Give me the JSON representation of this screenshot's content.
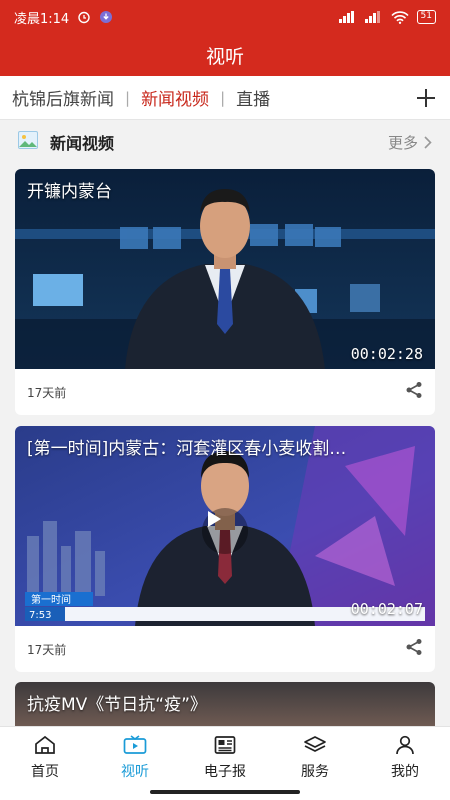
{
  "status_bar": {
    "time": "凌晨1:14",
    "battery": "51"
  },
  "header": {
    "title": "视听"
  },
  "tabs": [
    {
      "label": "杭锦后旗新闻",
      "active": false
    },
    {
      "label": "新闻视频",
      "active": true
    },
    {
      "label": "直播",
      "active": false
    }
  ],
  "section": {
    "title": "新闻视频",
    "more_label": "更多"
  },
  "videos": [
    {
      "title": "开镰内蒙台",
      "duration": "00:02:28",
      "age": "17天前"
    },
    {
      "title": "[第一时间]内蒙古：河套灌区春小麦收割…",
      "duration": "00:02:07",
      "age": "17天前"
    },
    {
      "title": "抗疫MV《节日抗“疫”》"
    }
  ],
  "bottom_nav": [
    {
      "label": "首页",
      "icon": "home-icon",
      "active": false
    },
    {
      "label": "视听",
      "icon": "tv-icon",
      "active": true
    },
    {
      "label": "电子报",
      "icon": "newspaper-icon",
      "active": false
    },
    {
      "label": "服务",
      "icon": "layers-icon",
      "active": false
    },
    {
      "label": "我的",
      "icon": "user-icon",
      "active": false
    }
  ],
  "colors": {
    "brand_red": "#d42a1e",
    "tab_active": "#c8281c",
    "nav_active": "#1a9bd7"
  }
}
